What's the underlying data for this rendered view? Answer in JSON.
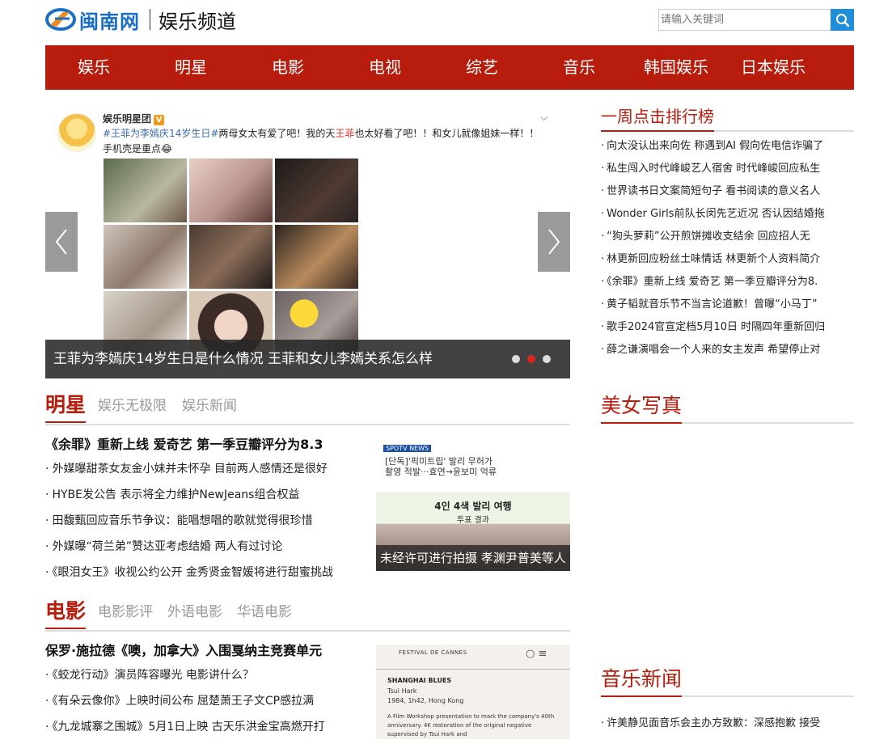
{
  "header": {
    "logo_text": "闽南网",
    "channel_title": "娱乐频道",
    "search_placeholder": "请输入关键词"
  },
  "nav": [
    "娱乐",
    "明星",
    "电影",
    "电视",
    "综艺",
    "音乐",
    "韩国娱乐",
    "日本娱乐"
  ],
  "slider": {
    "post_user": "娱乐明星团",
    "post_badge": "V",
    "post_tag": "#王菲为李嫣庆14岁生日#",
    "post_text_1": "两母女太有爱了吧！我的天",
    "post_name": "王菲",
    "post_text_2": "也太好看了吧！！和女儿就像姐妹一样！！手机壳是重点",
    "post_emoji": "😂",
    "caption": "王菲为李嫣庆14岁生日是什么情况 王菲和女儿李嫣关系怎么样",
    "active_dot": 1,
    "dot_count": 3
  },
  "ranking": {
    "title": "一周点击排行榜",
    "items": [
      "向太没认出来向佐 称遇到AI 假向佐电信诈骗了",
      "私生闯入时代峰峻艺人宿舍 时代峰峻回应私生",
      "世界读书日文案简短句子 看书阅读的意义名人",
      "Wonder Girls前队长闵先艺近况 否认因结婚拖",
      "“狗头萝莉”公开煎饼摊收支结余 回应招人无",
      "林更新回应粉丝土味情话 林更新个人资料简介",
      "《余罪》重新上线 爱奇艺 第一季豆瓣评分为8.",
      "黄子韬就音乐节不当言论道歉！曾曝“小马丁”",
      "歌手2024官宣定档5月10日 时隔四年重新回归",
      "薛之谦演唱会一个人来的女主发声 希望停止对"
    ]
  },
  "star": {
    "title": "明星",
    "subs": [
      "娱乐无极限",
      "娱乐新闻"
    ],
    "lead": "《余罪》重新上线 爱奇艺 第一季豆瓣评分为8.3",
    "items": [
      "外媒曝甜茶女友金小妹并未怀孕 目前两人感情还是很好",
      "HYBE发公告 表示将全力维护NewJeans组合权益",
      "田馥甄回应音乐节争议：能唱想唱的歌就觉得很珍惜",
      "外媒曝“荷兰弟”赞达亚考虑结婚 两人有过讨论",
      "《眼泪女王》收视公约公开 金秀贤金智媛将进行甜蜜挑战"
    ],
    "thumb_caption": "未经许可进行拍摄 孝渊尹普美等人",
    "thumb_header_1": "[단독]'픽미트립' 발리 무허가",
    "thumb_header_2": "촬영 적발···효연→윤보미 억류",
    "thumb_banner": "4인 4색 발리 여행",
    "thumb_banner_2": "투표 결과",
    "thumb_brand": "SPOTV NEWS"
  },
  "movie": {
    "title": "电影",
    "subs": [
      "电影影评",
      "外语电影",
      "华语电影"
    ],
    "lead": "保罗·施拉德《噢，加拿大》入围戛纳主竞赛单元",
    "items": [
      "《蛟龙行动》演员阵容曝光 电影讲什么？",
      "《有朵云像你》上映时间公布 屈楚萧王子文CP感拉满",
      "《九龙城寨之围城》5月1日上映 古天乐洪金宝高燃开打"
    ],
    "thumb_brand": "FESTIVAL DE CANNES",
    "thumb_title": "SHANGHAI BLUES",
    "thumb_director": "Tsui Hark",
    "thumb_meta": "1984, 1h42, Hong Kong",
    "thumb_desc": "A Film Workshop presentation to mark the company's 40th anniversary. 4K restoration of the original negative supervised by Tsui Hark and"
  },
  "beauty": {
    "title": "美女写真"
  },
  "music": {
    "title": "音乐新闻",
    "items": [
      "许美静见面音乐会主办方致歉：深感抱歉 接受"
    ]
  },
  "colors": {
    "brand_red": "#b71c0c",
    "brand_blue": "#1a6fc4",
    "search_blue": "#1f8ed8"
  },
  "icons": [
    "search-icon",
    "arrow-left-icon",
    "arrow-right-icon",
    "chevron-down-icon",
    "logo-icon"
  ]
}
